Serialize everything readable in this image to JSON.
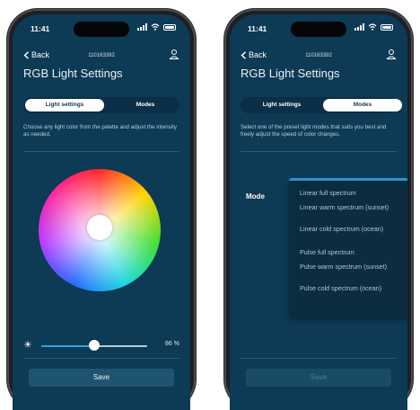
{
  "status_time": "11:41",
  "device_id": "110163392",
  "screen_title": "RGB Light Settings",
  "back_label": "Back",
  "tabs": {
    "light": "Light settings",
    "modes": "Modes"
  },
  "left": {
    "description": "Choose any light color from the palette and adjust the intensity as needed.",
    "brightness_fraction": 0.86,
    "brightness_label": "86 %",
    "save_label": "Save"
  },
  "right": {
    "description": "Select one of the preset light modes that suits you best and freely adjust the speed of color changes.",
    "mode_label": "Mode",
    "options": [
      "Linear full spectrum",
      "Linear warm spectrum (sunset)",
      "Linear cold spectrum (ocean)",
      "Pulse full spectrum",
      "Pulse warm spectrum (sunset)",
      "Pulse cold spectrum (ocean)"
    ],
    "save_label": "Save"
  },
  "colors": {
    "screen_bg": "#0d3a55",
    "accent": "#2ea3e0",
    "tab_active": "#ffffff"
  },
  "icons": [
    "back-chevron-icon",
    "user-icon",
    "sun-icon",
    "signal-icon",
    "wifi-icon",
    "battery-icon"
  ]
}
